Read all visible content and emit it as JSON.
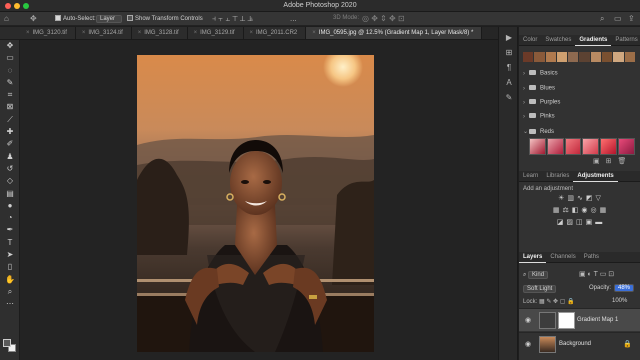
{
  "app": {
    "window_title": "Adobe Photoshop 2020"
  },
  "options_bar": {
    "auto_select_label": "Auto-Select:",
    "auto_select_checked": true,
    "auto_select_value": "Layer",
    "transform_controls_label": "Show Transform Controls",
    "transform_controls_checked": false,
    "mode_3d_label": "3D Mode:",
    "more_label": "..."
  },
  "document_tabs": [
    {
      "label": "IMG_3120.tif",
      "active": false
    },
    {
      "label": "IMG_3124.tif",
      "active": false
    },
    {
      "label": "IMG_3128.tif",
      "active": false
    },
    {
      "label": "IMG_3129.tif",
      "active": false
    },
    {
      "label": "IMG_2011.CR2",
      "active": false
    },
    {
      "label": "IMG_0595.jpg @ 12.5% (Gradient Map 1, Layer Mask/8) *",
      "active": true
    }
  ],
  "tools": [
    "move-tool",
    "artboard-tool",
    "lasso-tool",
    "quick-select-tool",
    "crop-tool",
    "frame-tool",
    "eyedropper-tool",
    "healing-tool",
    "brush-tool",
    "clone-stamp-tool",
    "history-brush-tool",
    "eraser-tool",
    "gradient-tool",
    "blur-tool",
    "dodge-tool",
    "pen-tool",
    "type-tool",
    "path-select-tool",
    "rectangle-tool",
    "hand-tool",
    "zoom-tool",
    "more-tools"
  ],
  "gradients_panel": {
    "tabs": [
      {
        "label": "Color",
        "active": false
      },
      {
        "label": "Swatches",
        "active": false
      },
      {
        "label": "Gradients",
        "active": true
      },
      {
        "label": "Patterns",
        "active": false
      }
    ],
    "top_swatches": [
      "#6b3a28",
      "#8a5a3a",
      "#b07a4e",
      "#cfa070",
      "#8e6a50",
      "#5c4232",
      "#b88a62",
      "#7a5030",
      "#d0a880",
      "#9c6e48"
    ],
    "folders": [
      {
        "label": "Basics",
        "open": false
      },
      {
        "label": "Blues",
        "open": false
      },
      {
        "label": "Purples",
        "open": false
      },
      {
        "label": "Pinks",
        "open": false
      },
      {
        "label": "Reds",
        "open": true
      }
    ],
    "reds_swatches": [
      "linear-gradient(135deg, #f4c2c2, #a01830)",
      "linear-gradient(135deg, #e9a0a8, #b01e3c)",
      "linear-gradient(135deg, #f07a80, #c2283c)",
      "linear-gradient(135deg, #f8a4a8, #d23a4a)",
      "linear-gradient(135deg, #ff6f6f, #b4142c)",
      "linear-gradient(135deg, #e84a7a, #8c1a40)"
    ]
  },
  "adjustments_panel": {
    "tabs": [
      {
        "label": "Learn",
        "active": false
      },
      {
        "label": "Libraries",
        "active": false
      },
      {
        "label": "Adjustments",
        "active": true
      }
    ],
    "add_label": "Add an adjustment"
  },
  "layers_panel": {
    "tabs": [
      {
        "label": "Layers",
        "active": true
      },
      {
        "label": "Channels",
        "active": false
      },
      {
        "label": "Paths",
        "active": false
      }
    ],
    "kind_label": "Kind",
    "blend_mode": "Soft Light",
    "opacity_label": "Opacity:",
    "opacity_value": "48%",
    "fill_value": "100%",
    "layers": [
      {
        "name": "Gradient Map 1",
        "visible": true
      },
      {
        "name": "Background",
        "visible": true,
        "locked": true
      }
    ]
  }
}
